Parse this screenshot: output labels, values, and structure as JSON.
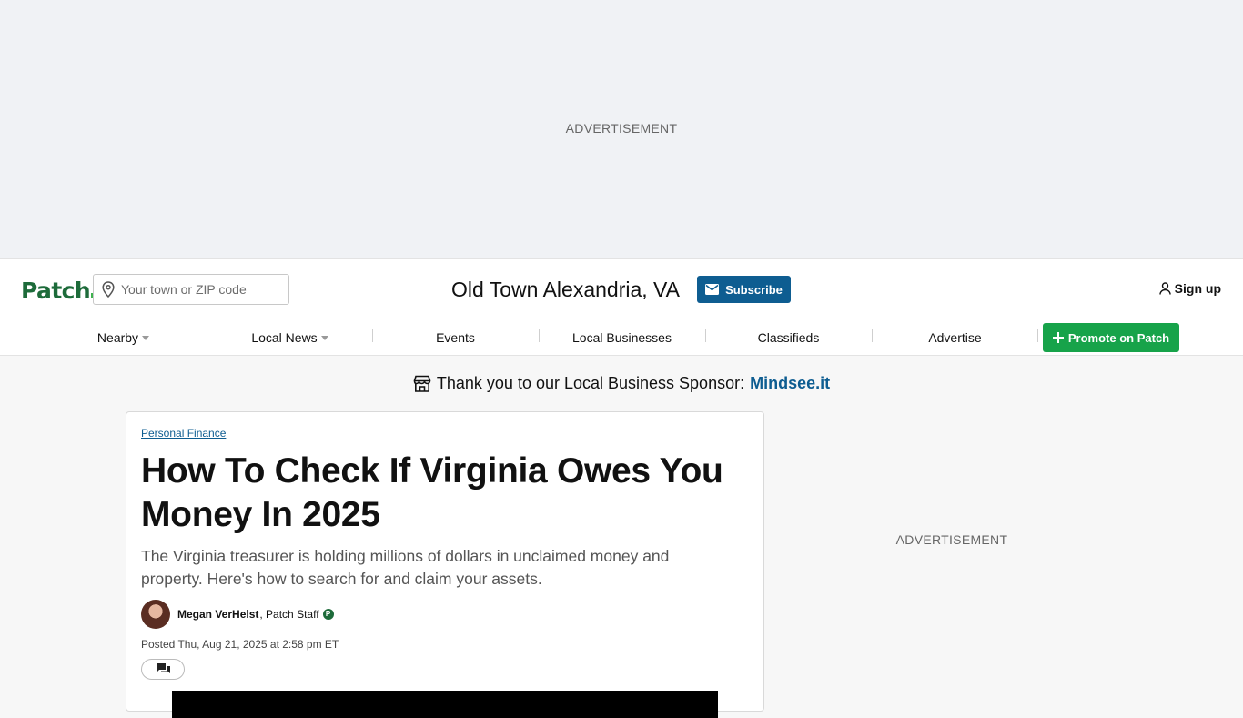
{
  "ads": {
    "top_label": "ADVERTISEMENT",
    "side_label": "ADVERTISEMENT"
  },
  "header": {
    "logo": "Patch",
    "search_placeholder": "Your town or ZIP code",
    "town": "Old Town Alexandria, VA",
    "subscribe_label": "Subscribe",
    "signup_label": "Sign up"
  },
  "nav": {
    "items": [
      {
        "label": "Nearby",
        "dropdown": true
      },
      {
        "label": "Local News",
        "dropdown": true
      },
      {
        "label": "Events",
        "dropdown": false
      },
      {
        "label": "Local Businesses",
        "dropdown": false
      },
      {
        "label": "Classifieds",
        "dropdown": false
      },
      {
        "label": "Advertise",
        "dropdown": false
      }
    ],
    "promote_label": "Promote on Patch"
  },
  "sponsor": {
    "text": "Thank you to our Local Business Sponsor:",
    "name": "Mindsee.it"
  },
  "article": {
    "category": "Personal Finance",
    "headline": "How To Check If Virginia Owes You Money In 2025",
    "dek": "The Virginia treasurer is holding millions of dollars in unclaimed money and property. Here's how to search for and claim your assets.",
    "author": "Megan VerHelst",
    "author_role": ", Patch Staff",
    "badge": "P",
    "posted": "Posted Thu, Aug 21, 2025 at 2:58 pm ET"
  },
  "colors": {
    "brand_green": "#1d6b3a",
    "subscribe_blue": "#0e5d91",
    "promote_green": "#17a34a"
  }
}
